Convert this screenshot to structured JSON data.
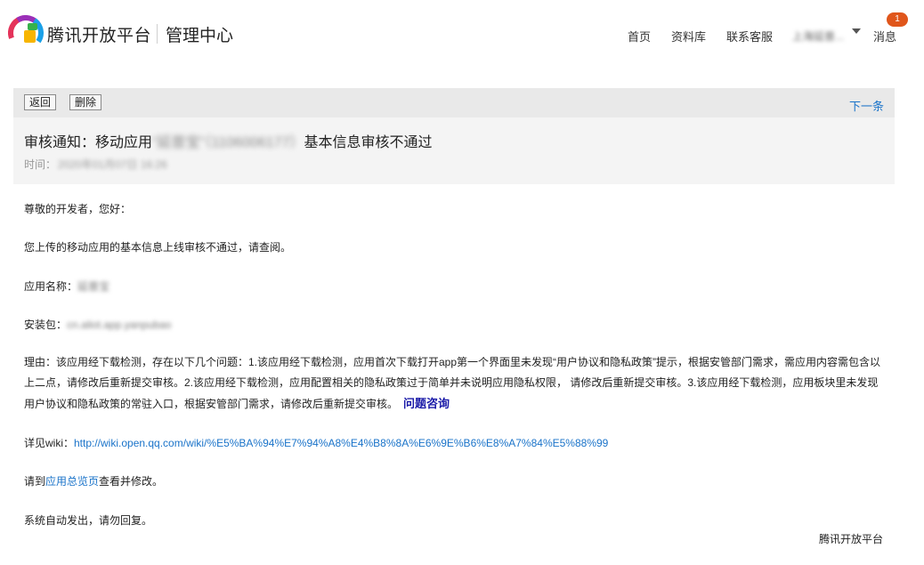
{
  "header": {
    "brand": "腾讯开放平台",
    "console": "管理中心",
    "nav": {
      "home": "首页",
      "docs": "资料库",
      "support": "联系客服",
      "user": "上海延普...",
      "messages": "消息",
      "message_count": "1"
    }
  },
  "toolbar": {
    "back_label": "返回",
    "delete_label": "删除",
    "next_label": "下一条"
  },
  "mail": {
    "subject_prefix": "审核通知：移动应用",
    "subject_app": "“延普宝”（1106006177）",
    "subject_suffix": "基本信息审核不通过",
    "time_label": "时间：",
    "time_value": "2020年01月07日 16:26",
    "greeting": "尊敬的开发者，您好：",
    "intro": "您上传的移动应用的基本信息上线审核不通过，请查阅。",
    "app_name_label": "应用名称：",
    "app_name_value": "延普宝",
    "package_label": "安装包：",
    "package_value": "cn.aliot.app.yanpubao",
    "reason": "理由：该应用经下载检测，存在以下几个问题：1.该应用经下载检测，应用首次下载打开app第一个界面里未发现“用户协议和隐私政策”提示，根据安管部门需求，需应用内容需包含以上二点，请修改后重新提交审核。2.该应用经下载检测，应用配置相关的隐私政策过于简单并未说明应用隐私权限， 请修改后重新提交审核。3.该应用经下载检测，应用板块里未发现用户协议和隐私政策的常驻入口，根据安管部门需求，请修改后重新提交审核。",
    "consult_link": "问题咨询",
    "wiki_label": "详见wiki：",
    "wiki_url": "http://wiki.open.qq.com/wiki/%E5%BA%94%E7%94%A8%E4%B8%8A%E6%9E%B6%E8%A7%84%E5%88%99",
    "visit_prefix": "请到",
    "visit_link": "应用总览页",
    "visit_suffix": "查看并修改。",
    "auto_notice": "系统自动发出，请勿回复。",
    "signature": "腾讯开放平台"
  }
}
